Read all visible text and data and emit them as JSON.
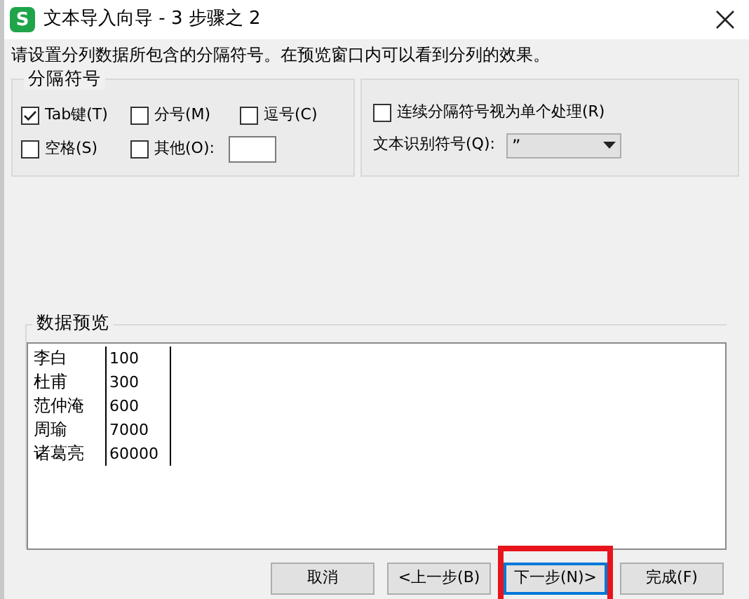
{
  "window": {
    "icon_letter": "S",
    "title": "文本导入向导 - 3 步骤之 2"
  },
  "instruction": "请设置分列数据所包含的分隔符号。在预览窗口内可以看到分列的效果。",
  "delimiters": {
    "legend": "分隔符号",
    "options": [
      {
        "label": "Tab键(T)",
        "checked": true
      },
      {
        "label": "分号(M)",
        "checked": false
      },
      {
        "label": "逗号(C)",
        "checked": false
      },
      {
        "label": "空格(S)",
        "checked": false
      },
      {
        "label": "其他(O):",
        "checked": false,
        "has_field": true
      }
    ]
  },
  "consecutive": {
    "label": "连续分隔符号视为单个处理(R)",
    "checked": false
  },
  "qualifier": {
    "label": "文本识别符号(Q):",
    "value": "”"
  },
  "preview": {
    "legend": "数据预览",
    "rows": [
      [
        "李白",
        "100"
      ],
      [
        "杜甫",
        "300"
      ],
      [
        "范仲淹",
        "600"
      ],
      [
        "周瑜",
        "7000"
      ],
      [
        "诸葛亮",
        "60000"
      ]
    ]
  },
  "buttons": [
    {
      "label": "取消",
      "focused": false,
      "highlighted": false
    },
    {
      "label": "<上一步(B)",
      "focused": false,
      "highlighted": false
    },
    {
      "label": "下一步(N)>",
      "focused": true,
      "highlighted": true
    },
    {
      "label": "完成(F)",
      "focused": false,
      "highlighted": false
    }
  ]
}
